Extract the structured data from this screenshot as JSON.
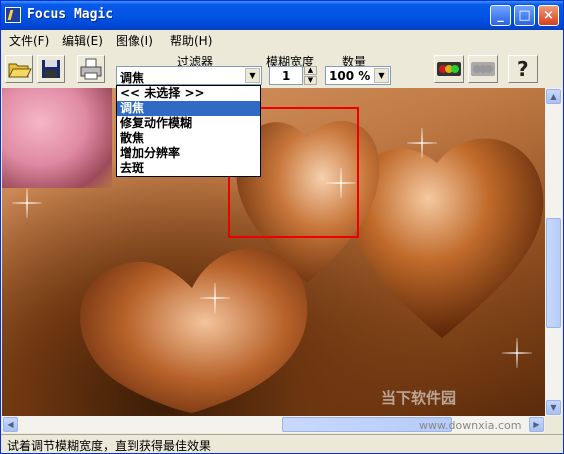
{
  "window": {
    "title": "Focus Magic",
    "min_glyph": "_",
    "max_glyph": "□",
    "close_glyph": "×"
  },
  "menu": {
    "items": [
      "文件(F)",
      "编辑(E)",
      "图像(I)",
      "帮助(H)"
    ]
  },
  "toolbar": {
    "filter_label": "过滤器",
    "filter_value": "调焦",
    "blur_width_label": "模糊宽度",
    "blur_width_value": "1",
    "amount_label": "数量",
    "amount_value": "100 %",
    "help_glyph": "?"
  },
  "dropdown": {
    "items": [
      "<< 未选择 >>",
      "调焦",
      "修复动作模糊",
      "散焦",
      "增加分辨率",
      "去斑"
    ],
    "selected_index": 1
  },
  "status": {
    "text": "试着调节模糊宽度，直到获得最佳效果"
  },
  "watermark": {
    "line1": "当下软件园",
    "line2": "www.downxia.com"
  },
  "colors": {
    "titlebar": "#0055e5",
    "selection": "#316ac5",
    "focus_box": "#e00000"
  }
}
